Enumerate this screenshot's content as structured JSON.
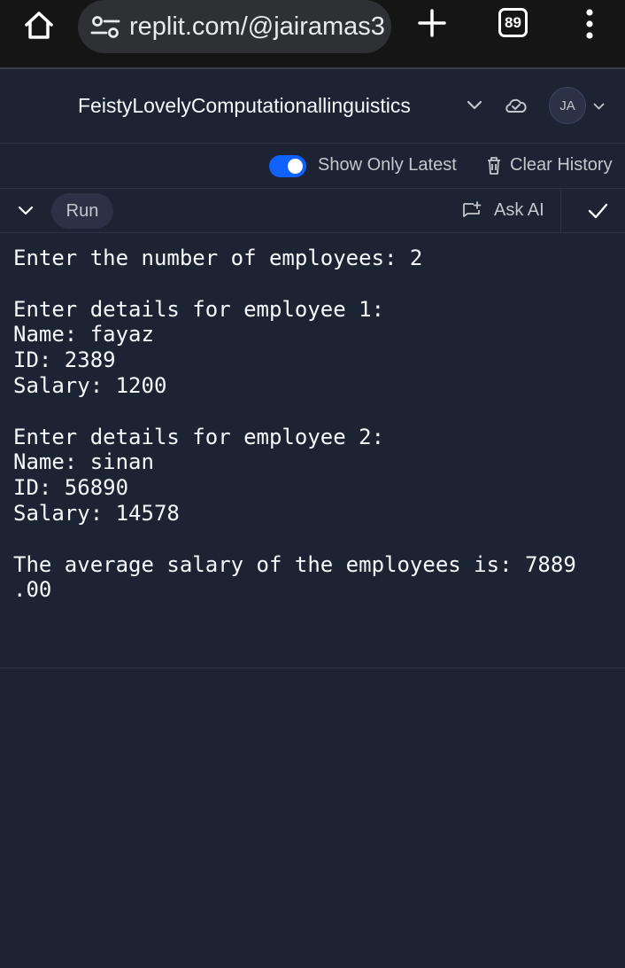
{
  "browser": {
    "url": "replit.com/@jairamas3",
    "tab_count": "89"
  },
  "repl": {
    "title": "FeistyLovelyComputationallinguistics",
    "avatar_initials": "JA"
  },
  "options": {
    "show_latest_label": "Show Only Latest",
    "show_latest_on": true,
    "clear_history_label": "Clear History"
  },
  "toolbar": {
    "run_label": "Run",
    "ask_ai_label": "Ask AI"
  },
  "console": {
    "lines": [
      "Enter the number of employees: 2",
      "",
      "Enter details for employee 1:",
      "Name: fayaz",
      "ID: 2389",
      "Salary: 1200",
      "",
      "Enter details for employee 2:",
      "Name: sinan",
      "ID: 56890",
      "Salary: 14578",
      "",
      "The average salary of the employees is: 7889",
      ".00"
    ]
  },
  "colors": {
    "background": "#1c2333",
    "toggle_accent": "#0f62fe",
    "text_primary": "#f5f9fc",
    "text_secondary": "#c2c8cc"
  }
}
